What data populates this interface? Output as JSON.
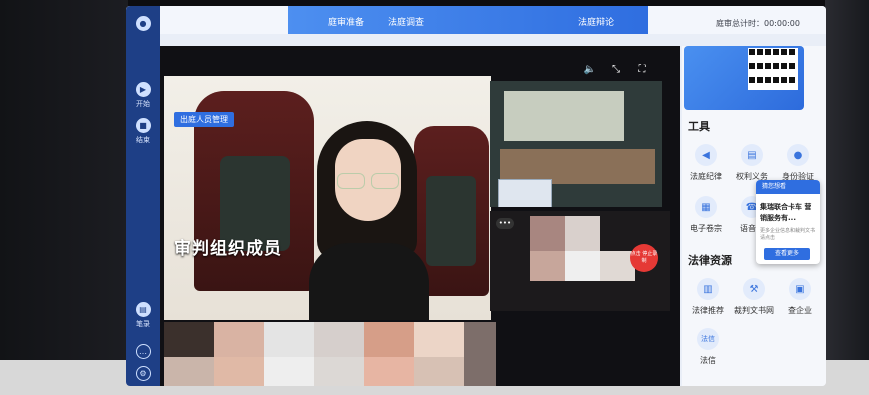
{
  "app": {
    "tabs": [
      "庭审准备",
      "法庭调查",
      "法庭辩论"
    ],
    "timer_label": "庭审总计时：00:00:00"
  },
  "left_rail": {
    "items": [
      {
        "label": "开始",
        "icon": "play-icon"
      },
      {
        "label": "结束",
        "icon": "stop-icon"
      },
      {
        "label": "笔录",
        "icon": "document-icon"
      }
    ]
  },
  "stage": {
    "role_badge": "出庭人员管理",
    "main_caption": "审判组织成员",
    "end_call": "点击 停止录制",
    "more": "•••"
  },
  "right_panel": {
    "tools_title": "工具",
    "tools": [
      {
        "label": "法庭纪律",
        "icon": "speaker-icon"
      },
      {
        "label": "权利义务",
        "icon": "document-icon"
      },
      {
        "label": "身份验证",
        "icon": "user-icon"
      },
      {
        "label": "电子卷宗",
        "icon": "folder-icon"
      },
      {
        "label": "语音电",
        "icon": "phone-icon"
      }
    ],
    "legal_title": "法律资源",
    "legal": [
      {
        "label": "法律推荐",
        "icon": "book-icon"
      },
      {
        "label": "裁判文书网",
        "icon": "gavel-icon"
      },
      {
        "label": "查企业",
        "icon": "building-icon"
      }
    ],
    "fa_xin_short": "法信",
    "fa_xin_label": "法信"
  },
  "popup": {
    "header": "猜您想看",
    "title": "集瑞联合卡车 营销服务有...",
    "desc": "更多企业信息和裁判文书请点击",
    "button": "查看更多"
  }
}
